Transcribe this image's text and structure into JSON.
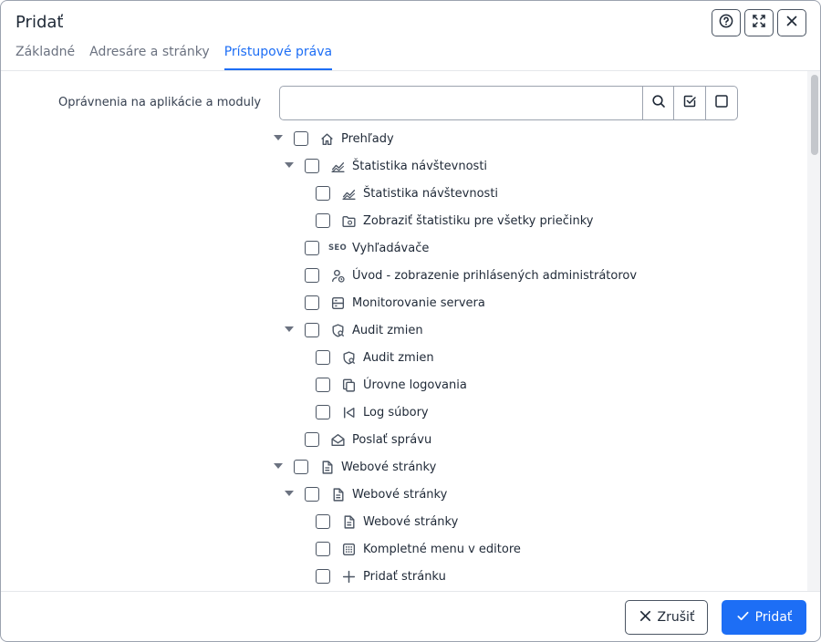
{
  "dialog": {
    "title": "Pridať",
    "colors": {
      "accent": "#1d6ef5",
      "border": "#4b5563"
    },
    "header_icons": [
      "help-icon",
      "fullscreen-icon",
      "close-icon"
    ]
  },
  "tabs": [
    {
      "label": "Základné",
      "active": false
    },
    {
      "label": "Adresáre a stránky",
      "active": false
    },
    {
      "label": "Prístupové práva",
      "active": true
    }
  ],
  "permissions": {
    "label": "Oprávnenia na aplikácie a moduly",
    "search_value": "",
    "search_placeholder": "",
    "buttons": [
      "search-icon",
      "check-all-icon",
      "uncheck-all-icon"
    ]
  },
  "tree": [
    {
      "label": "Prehľady",
      "icon": "home-icon",
      "level": 0,
      "expanded": true
    },
    {
      "label": "Štatistika návštevnosti",
      "icon": "chart-icon",
      "level": 1,
      "expanded": true
    },
    {
      "label": "Štatistika návštevnosti",
      "icon": "chart-icon",
      "level": 2
    },
    {
      "label": "Zobraziť štatistiku pre všetky priečinky",
      "icon": "folder-stats-icon",
      "level": 2
    },
    {
      "label": "Vyhľadávače",
      "icon": "seo-icon",
      "icon_text": "SEO",
      "level": 1
    },
    {
      "label": "Úvod - zobrazenie prihlásených administrátorov",
      "icon": "user-clock-icon",
      "level": 1
    },
    {
      "label": "Monitorovanie servera",
      "icon": "server-icon",
      "level": 1
    },
    {
      "label": "Audit zmien",
      "icon": "shield-search-icon",
      "level": 1,
      "expanded": true
    },
    {
      "label": "Audit zmien",
      "icon": "shield-search-icon",
      "level": 2
    },
    {
      "label": "Úrovne logovania",
      "icon": "copy-icon",
      "level": 2
    },
    {
      "label": "Log súbory",
      "icon": "skip-back-icon",
      "level": 2
    },
    {
      "label": "Poslať správu",
      "icon": "mail-open-icon",
      "level": 1
    },
    {
      "label": "Webové stránky",
      "icon": "file-text-icon",
      "level": 0,
      "expanded": true
    },
    {
      "label": "Webové stránky",
      "icon": "file-text-icon",
      "level": 1,
      "expanded": true
    },
    {
      "label": "Webové stránky",
      "icon": "file-text-icon",
      "level": 2
    },
    {
      "label": "Kompletné menu v editore",
      "icon": "grid-dots-icon",
      "level": 2
    },
    {
      "label": "Pridať stránku",
      "icon": "plus-icon",
      "level": 2
    }
  ],
  "footer": {
    "cancel_label": "Zrušiť",
    "submit_label": "Pridať"
  }
}
